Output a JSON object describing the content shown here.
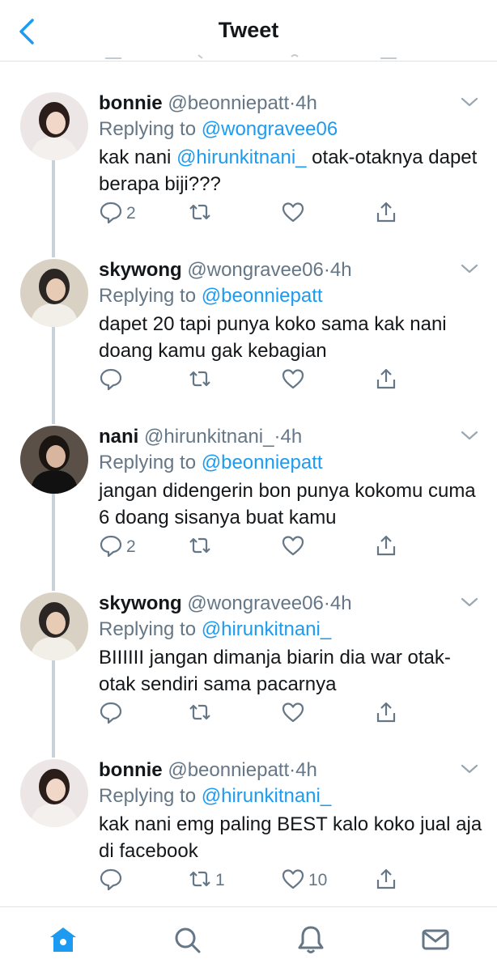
{
  "header": {
    "title": "Tweet"
  },
  "tweets": [
    {
      "name": "bonnie",
      "handle": "@beonniepatt",
      "dot": "·",
      "time": "4h",
      "replying_prefix": "Replying to",
      "replying_to": "@wongravee06",
      "body_pre": "kak nani ",
      "body_mention": "@hirunkitnani_",
      "body_post": " otak-otaknya dapet berapa biji???",
      "replies": "2",
      "retweets": "",
      "likes": ""
    },
    {
      "name": "skywong",
      "handle": "@wongravee06",
      "dot": "·",
      "time": "4h",
      "replying_prefix": "Replying to",
      "replying_to": "@beonniepatt",
      "body_pre": "dapet 20 tapi punya koko sama kak nani doang kamu gak kebagian",
      "body_mention": "",
      "body_post": "",
      "replies": "",
      "retweets": "",
      "likes": ""
    },
    {
      "name": "nani",
      "handle": "@hirunkitnani_",
      "dot": "·",
      "time": "4h",
      "replying_prefix": "Replying to",
      "replying_to": "@beonniepatt",
      "body_pre": "jangan didengerin bon punya kokomu cuma 6 doang sisanya buat kamu",
      "body_mention": "",
      "body_post": "",
      "replies": "2",
      "retweets": "",
      "likes": ""
    },
    {
      "name": "skywong",
      "handle": "@wongravee06",
      "dot": "·",
      "time": "4h",
      "replying_prefix": "Replying to",
      "replying_to": "@hirunkitnani_",
      "body_pre": "BIIIIII jangan dimanja biarin dia war otak-otak sendiri sama pacarnya",
      "body_mention": "",
      "body_post": "",
      "replies": "",
      "retweets": "",
      "likes": ""
    },
    {
      "name": "bonnie",
      "handle": "@beonniepatt",
      "dot": "·",
      "time": "4h",
      "replying_prefix": "Replying to",
      "replying_to": "@hirunkitnani_",
      "body_pre": "kak nani emg paling BEST kalo koko jual aja di facebook",
      "body_mention": "",
      "body_post": "",
      "replies": "",
      "retweets": "1",
      "likes": "10"
    }
  ],
  "icons": {
    "back": "chevron-left-icon",
    "more": "chevron-down-icon",
    "reply": "comment-icon",
    "retweet": "retweet-icon",
    "like": "heart-icon",
    "share": "share-icon",
    "tabs": [
      "home-icon",
      "search-icon",
      "notifications-icon",
      "messages-icon"
    ]
  },
  "colors": {
    "accent": "#1d9bf0",
    "secondary_text": "#657786",
    "thread_line": "#c9d2d8"
  }
}
